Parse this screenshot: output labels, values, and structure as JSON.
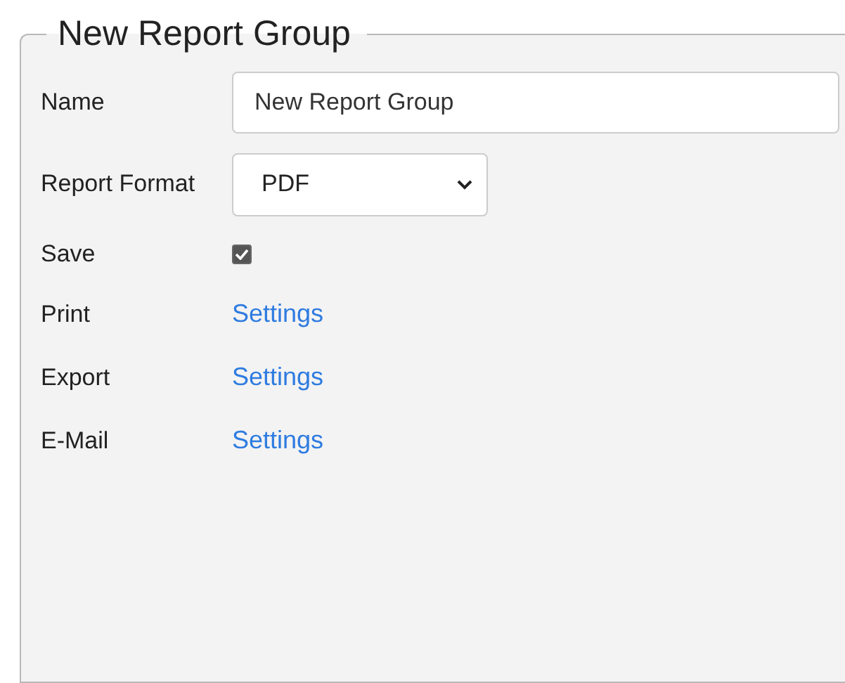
{
  "group": {
    "title": "New Report Group"
  },
  "fields": [
    {
      "kind": "text",
      "label": "Name",
      "value": "New Report Group"
    },
    {
      "kind": "select",
      "label": "Report Format",
      "value": "PDF"
    },
    {
      "kind": "checkbox",
      "label": "Save",
      "checked": true
    },
    {
      "kind": "link",
      "label": "Print",
      "link": "Settings"
    },
    {
      "kind": "link",
      "label": "Export",
      "link": "Settings"
    },
    {
      "kind": "link",
      "label": "E-Mail",
      "link": "Settings"
    }
  ]
}
